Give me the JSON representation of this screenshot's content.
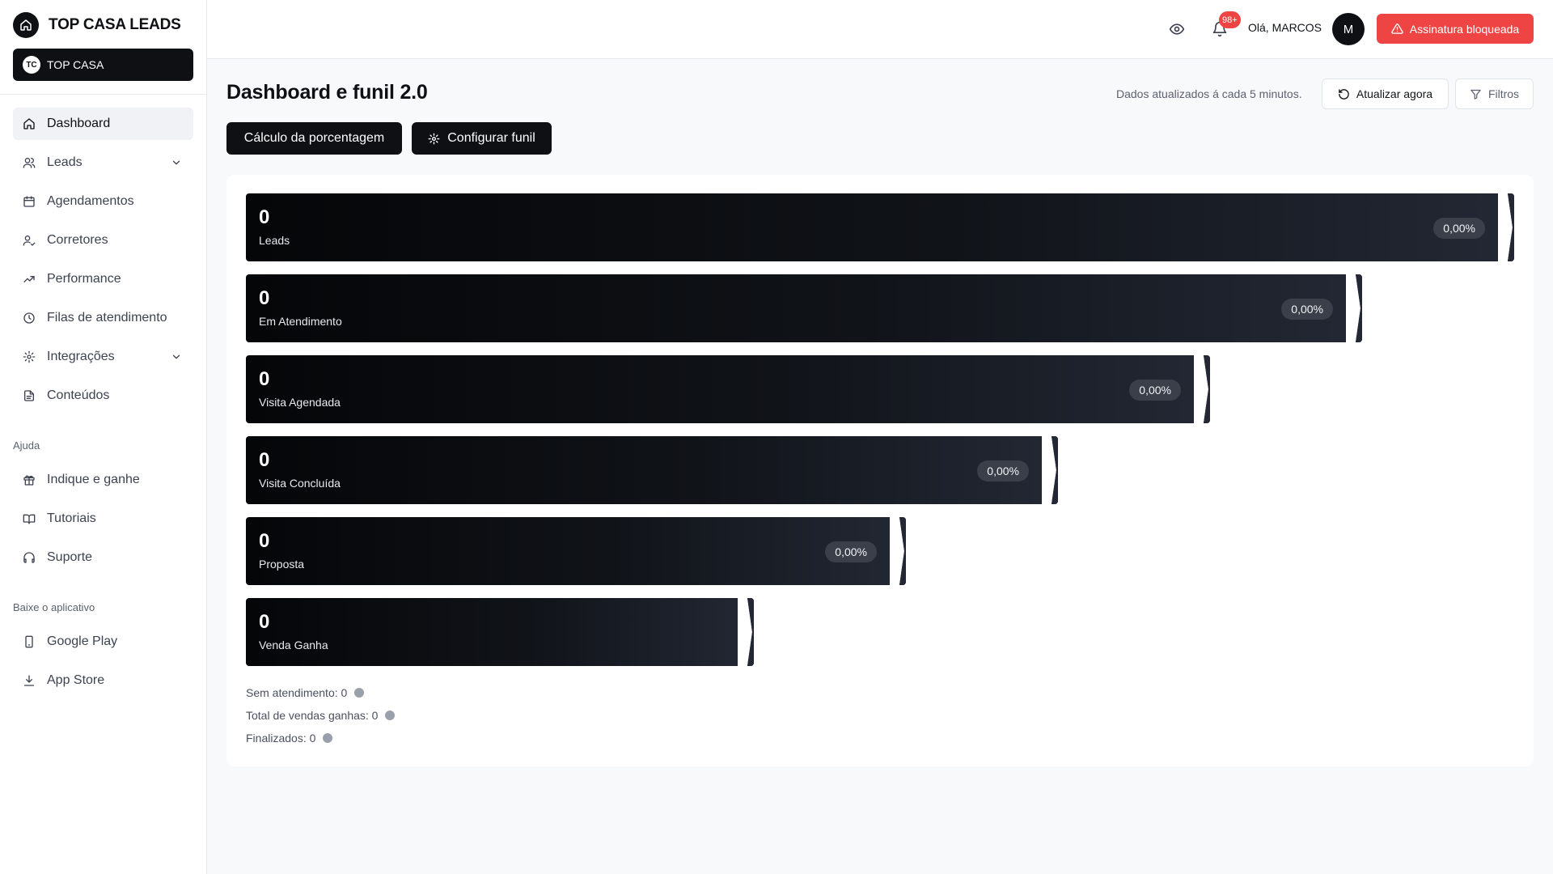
{
  "app": {
    "title": "TOP CASA LEADS"
  },
  "org": {
    "initials": "TC",
    "name": "TOP CASA"
  },
  "sidebar": {
    "items": [
      {
        "label": "Dashboard"
      },
      {
        "label": "Leads"
      },
      {
        "label": "Agendamentos"
      },
      {
        "label": "Corretores"
      },
      {
        "label": "Performance"
      },
      {
        "label": "Filas de atendimento"
      },
      {
        "label": "Integrações"
      },
      {
        "label": "Conteúdos"
      }
    ],
    "help_title": "Ajuda",
    "help_items": [
      {
        "label": "Indique e ganhe"
      },
      {
        "label": "Tutoriais"
      },
      {
        "label": "Suporte"
      }
    ],
    "app_title": "Baixe o aplicativo",
    "app_items": [
      {
        "label": "Google Play"
      },
      {
        "label": "App Store"
      }
    ]
  },
  "header": {
    "notification_count": "98+",
    "greeting": "Olá, MARCOS",
    "avatar_initial": "M",
    "subscription_label": "Assinatura bloqueada",
    "accent_red": "#ef4444"
  },
  "page": {
    "title": "Dashboard e funil 2.0",
    "updated_note": "Dados atualizados á cada 5 minutos.",
    "refresh_label": "Atualizar agora",
    "filters_label": "Filtros",
    "percent_calc_label": "Cálculo da porcentagem",
    "configure_funnel_label": "Configurar funil"
  },
  "funnel": {
    "stages": [
      {
        "value": "0",
        "label": "Leads",
        "percent": "0,00%"
      },
      {
        "value": "0",
        "label": "Em Atendimento",
        "percent": "0,00%"
      },
      {
        "value": "0",
        "label": "Visita Agendada",
        "percent": "0,00%"
      },
      {
        "value": "0",
        "label": "Visita Concluída",
        "percent": "0,00%"
      },
      {
        "value": "0",
        "label": "Proposta",
        "percent": "0,00%"
      },
      {
        "value": "0",
        "label": "Venda Ganha"
      }
    ],
    "summary": [
      {
        "text": "Sem atendimento: 0"
      },
      {
        "text": "Total de vendas ganhas: 0"
      },
      {
        "text": "Finalizados: 0"
      }
    ]
  }
}
